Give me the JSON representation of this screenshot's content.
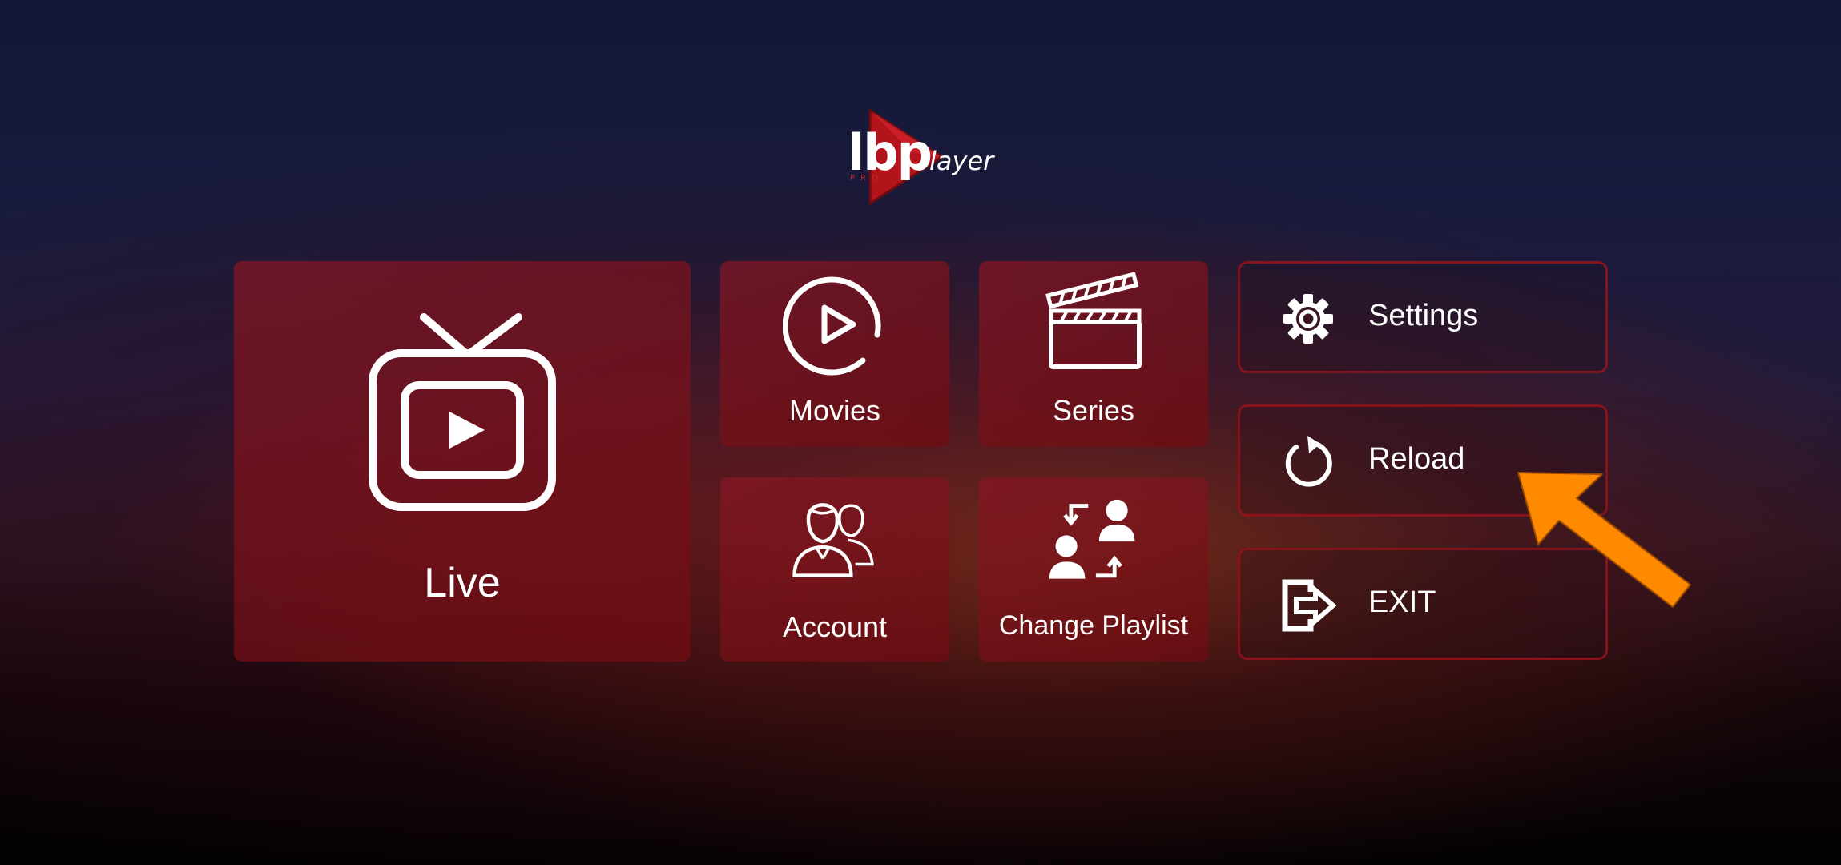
{
  "app": {
    "logo_main": "lbp",
    "logo_sub": "layer",
    "logo_tag": "PRO"
  },
  "tiles": {
    "live": {
      "label": "Live",
      "icon": "tv-icon"
    },
    "movies": {
      "label": "Movies",
      "icon": "play-circle-icon"
    },
    "series": {
      "label": "Series",
      "icon": "clapperboard-icon"
    },
    "account": {
      "label": "Account",
      "icon": "users-icon"
    },
    "playlist": {
      "label": "Change Playlist",
      "icon": "switch-user-icon"
    }
  },
  "side_buttons": {
    "settings": {
      "label": "Settings",
      "icon": "gear-icon"
    },
    "reload": {
      "label": "Reload",
      "icon": "reload-icon"
    },
    "exit": {
      "label": "EXIT",
      "icon": "exit-icon"
    }
  },
  "colors": {
    "brand_red": "#c0262c",
    "tile_red": "#8a1624",
    "highlight_arrow": "#ff8a00"
  }
}
